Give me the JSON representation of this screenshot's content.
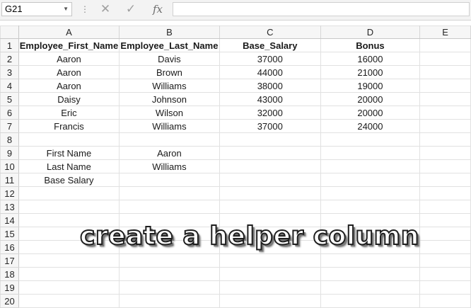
{
  "name_box": "G21",
  "formula_bar": {
    "cancel_icon": "close-icon",
    "enter_icon": "check-icon",
    "fx_label": "fx",
    "formula_value": ""
  },
  "columns": [
    "A",
    "B",
    "C",
    "D",
    "E"
  ],
  "rows": [
    {
      "num": "1",
      "cells": [
        "Employee_First_Name",
        "Employee_Last_Name",
        "Base_Salary",
        "Bonus",
        ""
      ]
    },
    {
      "num": "2",
      "cells": [
        "Aaron",
        "Davis",
        "37000",
        "16000",
        ""
      ]
    },
    {
      "num": "3",
      "cells": [
        "Aaron",
        "Brown",
        "44000",
        "21000",
        ""
      ]
    },
    {
      "num": "4",
      "cells": [
        "Aaron",
        "Williams",
        "38000",
        "19000",
        ""
      ]
    },
    {
      "num": "5",
      "cells": [
        "Daisy",
        "Johnson",
        "43000",
        "20000",
        ""
      ]
    },
    {
      "num": "6",
      "cells": [
        "Eric",
        "Wilson",
        "32000",
        "20000",
        ""
      ]
    },
    {
      "num": "7",
      "cells": [
        "Francis",
        "Williams",
        "37000",
        "24000",
        ""
      ]
    },
    {
      "num": "8",
      "cells": [
        "",
        "",
        "",
        "",
        ""
      ]
    },
    {
      "num": "9",
      "cells": [
        "First Name",
        "Aaron",
        "",
        "",
        ""
      ]
    },
    {
      "num": "10",
      "cells": [
        "Last Name",
        "Williams",
        "",
        "",
        ""
      ]
    },
    {
      "num": "11",
      "cells": [
        "Base Salary",
        "",
        "",
        "",
        ""
      ]
    },
    {
      "num": "12",
      "cells": [
        "",
        "",
        "",
        "",
        ""
      ]
    },
    {
      "num": "13",
      "cells": [
        "",
        "",
        "",
        "",
        ""
      ]
    },
    {
      "num": "14",
      "cells": [
        "",
        "",
        "",
        "",
        ""
      ]
    },
    {
      "num": "15",
      "cells": [
        "",
        "",
        "",
        "",
        ""
      ]
    },
    {
      "num": "16",
      "cells": [
        "",
        "",
        "",
        "",
        ""
      ]
    },
    {
      "num": "17",
      "cells": [
        "",
        "",
        "",
        "",
        ""
      ]
    },
    {
      "num": "18",
      "cells": [
        "",
        "",
        "",
        "",
        ""
      ]
    },
    {
      "num": "19",
      "cells": [
        "",
        "",
        "",
        "",
        ""
      ]
    },
    {
      "num": "20",
      "cells": [
        "",
        "",
        "",
        "",
        ""
      ]
    }
  ],
  "overlay_caption": "create a helper column"
}
